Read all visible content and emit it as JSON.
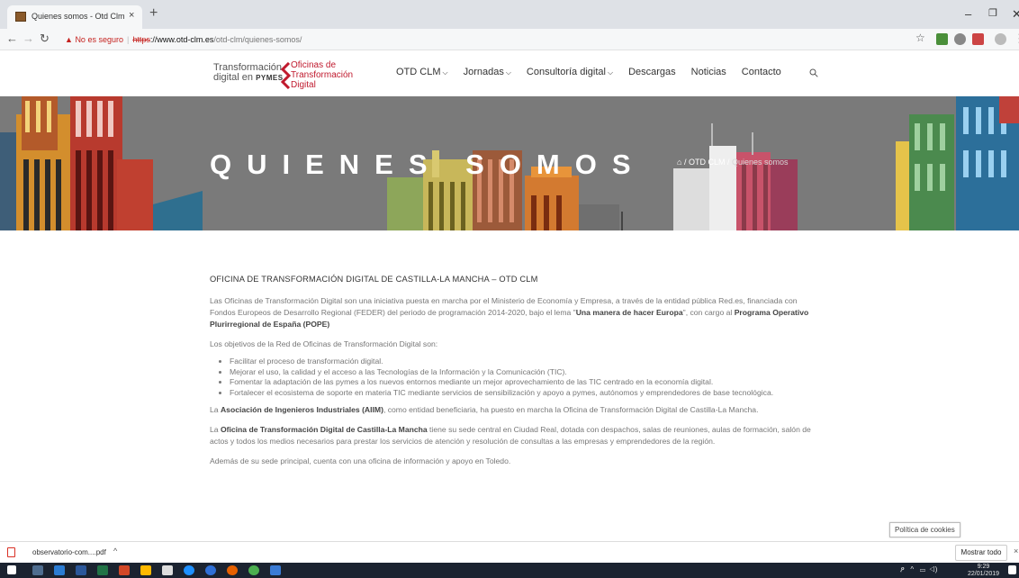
{
  "browser": {
    "tab_title": "Quienes somos - Otd Clm",
    "tab_close": "×",
    "new_tab": "+",
    "security_warning": "No es seguro",
    "url_protocol": "https",
    "url_host": "://www.otd-clm.es",
    "url_path": "/otd-clm/quienes-somos/",
    "icons": [
      "back-icon",
      "forward-icon",
      "reload-icon",
      "star-icon",
      "minimize-icon",
      "maximize-icon",
      "close-icon"
    ]
  },
  "site": {
    "logo_left_line1": "Transformación",
    "logo_left_line2": "digital en ",
    "logo_left_pymes": "PYMES",
    "logo_right_line1": "Oficinas de",
    "logo_right_line2": "Transformación",
    "logo_right_line3": "Digital",
    "nav": [
      {
        "label": "OTD CLM",
        "dropdown": true
      },
      {
        "label": "Jornadas",
        "dropdown": true
      },
      {
        "label": "Consultoría digital",
        "dropdown": true
      },
      {
        "label": "Descargas",
        "dropdown": false
      },
      {
        "label": "Noticias",
        "dropdown": false
      },
      {
        "label": "Contacto",
        "dropdown": false
      }
    ],
    "accent_color": "#c01a2e"
  },
  "hero": {
    "title": "QUIENES SOMOS",
    "breadcrumb_home": "⌂",
    "breadcrumb_sep1": " / ",
    "breadcrumb_parent": "OTD CLM",
    "breadcrumb_sep2": " / ",
    "breadcrumb_current": "Quienes somos"
  },
  "content": {
    "heading": "OFICINA DE TRANSFORMACIÓN DIGITAL DE CASTILLA-LA MANCHA – OTD CLM",
    "p1_a": "Las Oficinas de Transformación Digital son una iniciativa puesta en marcha por el Ministerio de Economía y Empresa, a través de la entidad pública Red.es, financiada con Fondos Europeos de Desarrollo Regional (FEDER) del periodo de programación 2014-2020, bajo el lema \"",
    "p1_b": "Una manera de hacer Europa",
    "p1_c": "\", con cargo al ",
    "p1_d": "Programa Operativo Plurirregional de España (POPE)",
    "p2": "Los objetivos de la Red de Oficinas de Transformación Digital son:",
    "bullets": [
      "Facilitar el proceso de transformación digital.",
      "Mejorar el uso, la calidad y el acceso a las Tecnologías de la Información y la Comunicación (TIC).",
      "Fomentar la adaptación de las pymes a los nuevos entornos mediante un mejor aprovechamiento de las TIC centrado en la economía digital.",
      "Fortalecer el ecosistema de soporte en materia TIC mediante servicios de sensibilización y apoyo a pymes, autónomos y emprendedores de base tecnológica."
    ],
    "p3_a": "La ",
    "p3_b": "Asociación de Ingenieros Industriales (AIIM)",
    "p3_c": ", como entidad beneficiaria, ha puesto en marcha la Oficina de Transformación Digital de Castilla-La Mancha.",
    "p4_a": "La ",
    "p4_b": "Oficina de Transformación Digital de Castilla-La Mancha",
    "p4_c": " tiene su sede central en Ciudad Real, dotada con despachos, salas de reuniones, aulas de formación, salón de actos y todos los medios necesarios para prestar los servicios de atención y resolución de consultas a las empresas y emprendedores de la región.",
    "p5": "Además de su sede principal, cuenta con una oficina de información y apoyo en Toledo."
  },
  "cookies_label": "Política de cookies",
  "downloads": {
    "file_name": "observatorio-com....pdf",
    "chevron": "^",
    "show_all": "Mostrar todo",
    "close": "×"
  },
  "taskbar": {
    "time": "9:29",
    "date": "22/01/2019"
  }
}
